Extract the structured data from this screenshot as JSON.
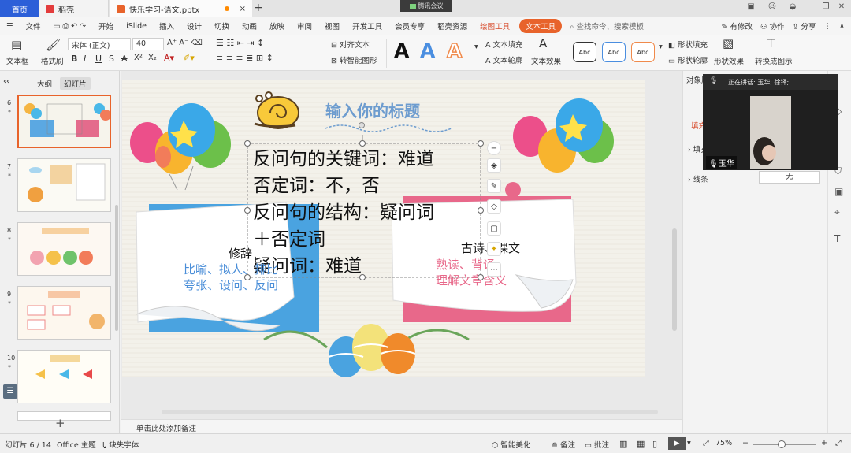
{
  "titlebar": {
    "home_tab": "首页",
    "wps_tab": "稻壳",
    "doc_tab": "快乐学习-语文.pptx",
    "add_tab": "+",
    "meeting_label": "腾讯会议"
  },
  "menu": {
    "file": "文件",
    "items": [
      "开始",
      "iSlide",
      "插入",
      "设计",
      "切换",
      "动画",
      "放映",
      "审阅",
      "视图",
      "开发工具",
      "会员专享",
      "稻壳资源"
    ],
    "drawing_tools": "绘图工具",
    "text_tools": "文本工具",
    "search_placeholder": "查找命令、搜索模板",
    "has_changes": "有修改",
    "collaborate": "协作",
    "share": "分享"
  },
  "ribbon": {
    "textbox": "文本框",
    "format_painter": "格式刷",
    "font_name": "宋体 (正文)",
    "font_size": "40",
    "align_text": "对齐文本",
    "smart_shape": "转智能图形",
    "text_fill": "文本填充",
    "text_outline": "文本轮廓",
    "text_effect": "文本效果",
    "style_sample": "Abc",
    "shape_fill": "形状填充",
    "shape_outline": "形状轮廓",
    "shape_effect": "形状效果",
    "convert_diagram": "转换成图示",
    "big_a": "A"
  },
  "left_panel": {
    "outline_tab": "大纲",
    "slides_tab": "幻灯片",
    "slide_numbers": [
      "6",
      "7",
      "8",
      "9",
      "10"
    ],
    "star": "*",
    "add": "+"
  },
  "slide": {
    "title": "输入你的标题",
    "body_lines": [
      "反问句的关键词：难道",
      "否定词：不，否",
      "反问句的结构：疑问词",
      "＋否定词",
      "疑问词：难道"
    ],
    "left_label": "修辞",
    "left_line1": "比喻、拟人、排比",
    "left_line2": "夸张、设问、反问",
    "right_label": "古诗、课文",
    "right_line1": "熟读、背诵",
    "right_line2": "理解文章含义",
    "colors": {
      "left_note": "#4aa3e0",
      "right_note": "#e8688a",
      "title": "#6d9ccf"
    }
  },
  "notes_placeholder": "单击此处添加备注",
  "right_panel": {
    "header": "对象属性",
    "fill_tab": "填充",
    "fill_label": "填充",
    "line_label": "线条",
    "line_value": "无"
  },
  "video": {
    "speaking": "正在讲话: 玉华; 徐铎;",
    "name": "玉华"
  },
  "status": {
    "slide_count": "幻灯片 6 / 14",
    "theme": "Office 主题",
    "missing_font": "缺失字体",
    "smart_beautify": "智能美化",
    "notes": "备注",
    "comments": "批注",
    "zoom": "75%",
    "zoom_minus": "−",
    "zoom_plus": "+",
    "zoom_fraction": 0.45
  }
}
